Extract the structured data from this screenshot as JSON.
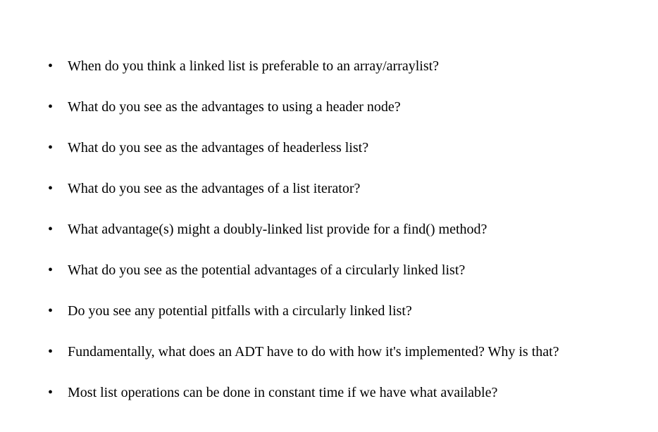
{
  "items": [
    "When do you think a linked list is preferable to an array/arraylist?",
    "What do you see as the advantages to using a header node?",
    "What do you see as the advantages of headerless list?",
    "What do you see as the advantages of a list iterator?",
    "What advantage(s) might a doubly-linked list provide for a find() method?",
    "What do you see as the potential advantages of a circularly linked list?",
    "Do you see any potential pitfalls with a circularly linked list?",
    "Fundamentally, what does an ADT have to do with how it's implemented? Why is that?",
    "Most list operations can be done in constant time if we have what available?"
  ]
}
